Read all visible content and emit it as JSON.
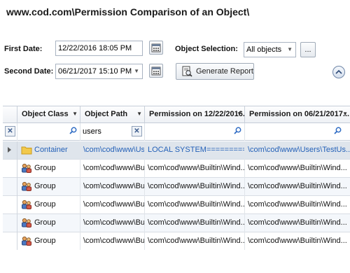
{
  "title": "www.cod.com\\Permission Comparison of an Object\\",
  "form": {
    "first_date_label": "First Date:",
    "first_date_value": "12/22/2016 18:05 PM",
    "second_date_label": "Second Date:",
    "second_date_value": "06/21/2017 15:10 PM",
    "object_selection_label": "Object Selection:",
    "object_selection_value": "All objects",
    "browse_label": "...",
    "generate_report_label": "Generate Report"
  },
  "grid": {
    "columns": [
      "Object Class",
      "Object Path",
      "Permission on 12/22/2016...",
      "Permission on 06/21/2017..."
    ],
    "filter": {
      "object_path": "users"
    },
    "rows": [
      {
        "class": "Container",
        "path": "\\com\\cod\\www\\Us...",
        "perm1": "LOCAL SYSTEM===========...",
        "perm2": "\\com\\cod\\www\\Users\\TestUs..."
      },
      {
        "class": "Group",
        "path": "\\com\\cod\\www\\Bu...",
        "perm1": "\\com\\cod\\www\\Builtin\\Wind...",
        "perm2": "\\com\\cod\\www\\Builtin\\Wind..."
      },
      {
        "class": "Group",
        "path": "\\com\\cod\\www\\Bu...",
        "perm1": "\\com\\cod\\www\\Builtin\\Wind...",
        "perm2": "\\com\\cod\\www\\Builtin\\Wind..."
      },
      {
        "class": "Group",
        "path": "\\com\\cod\\www\\Bu...",
        "perm1": "\\com\\cod\\www\\Builtin\\Wind...",
        "perm2": "\\com\\cod\\www\\Builtin\\Wind..."
      },
      {
        "class": "Group",
        "path": "\\com\\cod\\www\\Bu...",
        "perm1": "\\com\\cod\\www\\Builtin\\Wind...",
        "perm2": "\\com\\cod\\www\\Builtin\\Wind..."
      },
      {
        "class": "Group",
        "path": "\\com\\cod\\www\\Bu...",
        "perm1": "\\com\\cod\\www\\Builtin\\Wind...",
        "perm2": "\\com\\cod\\www\\Builtin\\Wind..."
      }
    ]
  },
  "icons": {
    "calendar": "calendar-icon",
    "report": "report-icon",
    "collapse": "collapse-up-icon",
    "search": "search-icon",
    "clear": "clear-filter-icon",
    "folder": "folder-icon",
    "group": "group-icon"
  },
  "colors": {
    "link": "#2461b8",
    "folder": "#f2c94c"
  }
}
